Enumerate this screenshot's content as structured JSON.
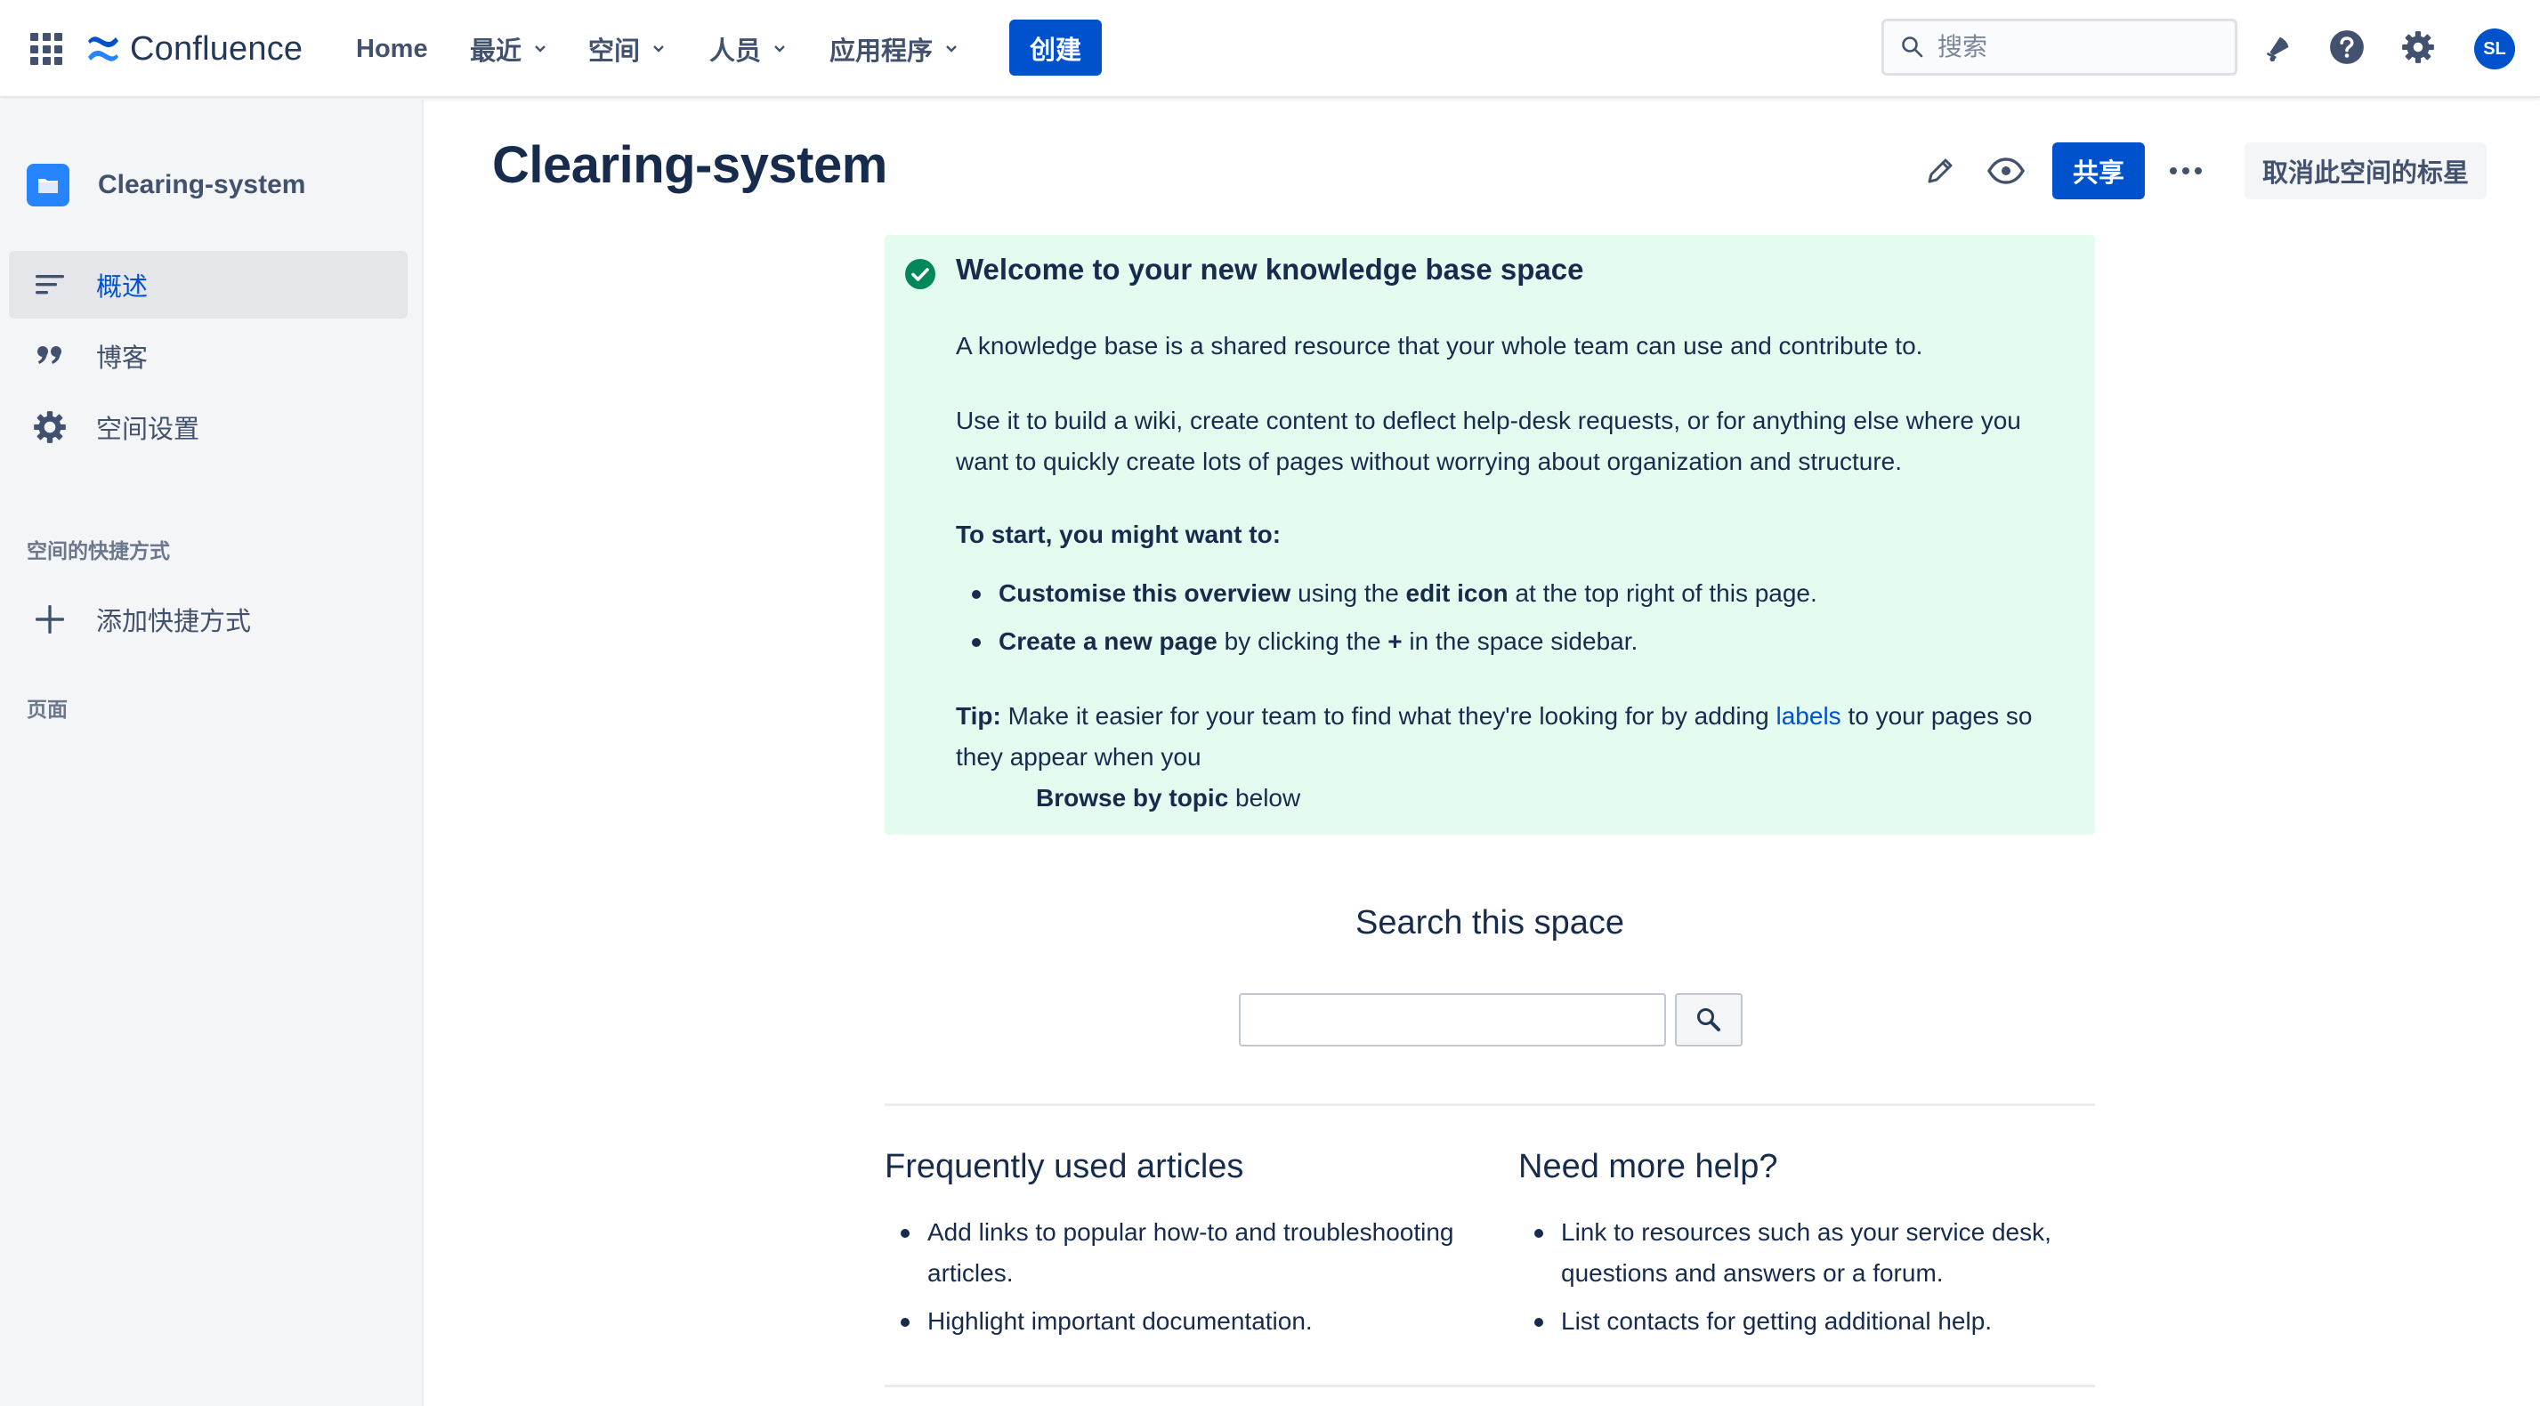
{
  "topnav": {
    "logo_text": "Confluence",
    "items": [
      {
        "label": "Home",
        "dropdown": false
      },
      {
        "label": "最近",
        "dropdown": true
      },
      {
        "label": "空间",
        "dropdown": true
      },
      {
        "label": "人员",
        "dropdown": true
      },
      {
        "label": "应用程序",
        "dropdown": true
      }
    ],
    "create_label": "创建",
    "search_placeholder": "搜索",
    "avatar_initials": "SL",
    "accent_color": "#0052cc"
  },
  "sidebar": {
    "space_name": "Clearing-system",
    "items": [
      {
        "label": "概述",
        "icon": "overview-icon",
        "active": true
      },
      {
        "label": "博客",
        "icon": "quote-icon",
        "active": false
      },
      {
        "label": "空间设置",
        "icon": "gear-icon",
        "active": false
      }
    ],
    "shortcuts_heading": "空间的快捷方式",
    "add_shortcut_label": "添加快捷方式",
    "pages_heading": "页面"
  },
  "main": {
    "title": "Clearing-system",
    "share_label": "共享",
    "unstar_label": "取消此空间的标星",
    "panel": {
      "title": "Welcome to your new knowledge base space",
      "intro": "A knowledge base is a shared resource that your whole team can use and contribute to.",
      "use_line1": "Use it to build a wiki, create content to deflect help-desk requests, or for anything else where you",
      "use_line2": "want to quickly create lots of pages without worrying about organization and structure.",
      "start_heading": "To start, you might want to:",
      "bullet1": {
        "b1": "Customise this overview",
        "t1": " using the ",
        "b2": "edit icon",
        "t2": " at the top right of this page."
      },
      "bullet2": {
        "b1": "Create a new page",
        "t1": " by clicking the ",
        "b2": "+",
        "t2": " in the space sidebar."
      },
      "tip": {
        "label": "Tip:",
        "text1": " Make it easier for your team to find what they're looking for by adding ",
        "link": "labels",
        "text2": " to your pages so",
        "line2": "they appear when you",
        "b3": "Browse by topic",
        "t3": " below"
      }
    },
    "search_heading": "Search this space",
    "frequent": {
      "title": "Frequently used articles",
      "items": [
        "Add links to popular how-to and troubleshooting articles.",
        "Highlight important documentation."
      ]
    },
    "help": {
      "title": "Need more help?",
      "items": [
        "Link to resources such as your service desk, questions and answers or a forum.",
        "List contacts for getting additional help."
      ]
    }
  }
}
